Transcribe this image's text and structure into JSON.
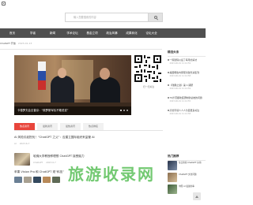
{
  "search": {
    "placeholder": "输入您要搜索的内容"
  },
  "nav": {
    "items": [
      "首页",
      "学者",
      "新闻",
      "学术论坛",
      "基金立项",
      "政治风暴",
      "成果转化",
      "论坛大全"
    ]
  },
  "notice": {
    "text": "ChatGPT 开放",
    "date": "2023-01-13"
  },
  "hero": {
    "caption": "卡德罗夫会见普京：“俄罗斯军队不敢说说”"
  },
  "qr": {
    "caption": "扫一扫关注"
  },
  "tabs": [
    "热点资讯",
    "最新资讯",
    "最热资讯",
    "热点排名"
  ],
  "list": [
    {
      "title": "AI 风险引起担忧！“ChatGPT 之父”：应建立国际组织来监管 AI",
      "meta": [
        "AI",
        "2023-6-7"
      ]
    },
    {
      "title": "哈佛大学教授称理想 ChatGPT 接受脑力",
      "meta": [
        "ChatGPT",
        "2023-6-7"
      ]
    },
    {
      "title": "苹果 Vision Pro 和 ChatGPT 现“科技”",
      "meta": []
    }
  ],
  "sidebar": {
    "title": "精选头条",
    "items": [
      {
        "title": "一院建院以后了每月的采访",
        "date": "2023-06-01 11:12:59"
      },
      {
        "title": "美国哪些内容现对政务采集到",
        "date": "2023-06-01 11:12:58"
      },
      {
        "title": "《瑞典之谜》第 1 期研",
        "date": "2023-06-01 11:12:59"
      },
      {
        "title": "79岁首都收度研制新总统的问题",
        "date": "2023-06-01 11:12:55"
      },
      {
        "title": "高管带领人人人为目更多关注",
        "date": "2023-06-01 11:12:58"
      }
    ],
    "hot_title": "热门推荐",
    "hot": [
      {
        "text": "每日新闻 ChatGPT 好用"
      },
      {
        "text": "ChatGPT 文化问题"
      },
      {
        "text": "中国 AI 发展的事"
      }
    ]
  },
  "watermark": "旅游收录网",
  "colors": {
    "nav_bg": "#505050",
    "accent": "#e8453c",
    "watermark": "#4cba4a"
  }
}
